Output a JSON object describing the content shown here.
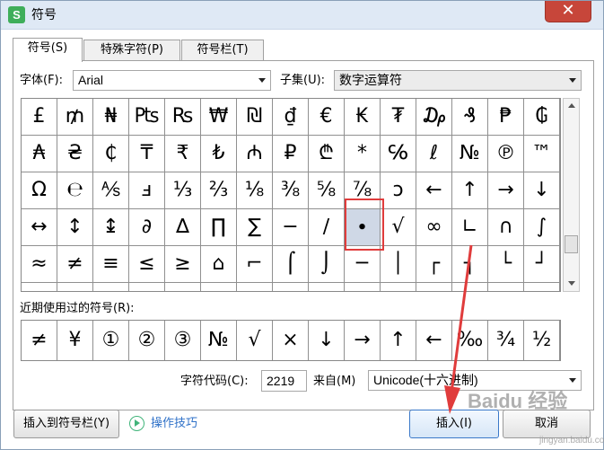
{
  "window": {
    "title": "符号",
    "app_icon_letter": "S",
    "close_label": "✕"
  },
  "tabs": [
    {
      "label": "符号(S)",
      "active": true
    },
    {
      "label": "特殊字符(P)",
      "active": false
    },
    {
      "label": "符号栏(T)",
      "active": false
    }
  ],
  "font": {
    "label": "字体(F):",
    "value": "Arial"
  },
  "subset": {
    "label": "子集(U):",
    "value": "数字运算符"
  },
  "grid": {
    "rows": [
      [
        "£",
        "₥",
        "₦",
        "₧",
        "₨",
        "₩",
        "₪",
        "₫",
        "€",
        "₭",
        "₮",
        "₯",
        "₰",
        "₱",
        "₲"
      ],
      [
        "₳",
        "₴",
        "₵",
        "₸",
        "₹",
        "₺",
        "₼",
        "₽",
        "₾",
        "*",
        "℅",
        "ℓ",
        "№",
        "℗",
        "™"
      ],
      [
        "Ω",
        "℮",
        "⅍",
        "ⅎ",
        "⅓",
        "⅔",
        "⅛",
        "⅜",
        "⅝",
        "⅞",
        "ↄ",
        "←",
        "↑",
        "→",
        "↓"
      ],
      [
        "↔",
        "↕",
        "↨",
        "∂",
        "∆",
        "∏",
        "∑",
        "−",
        "∕",
        "∙",
        "√",
        "∞",
        "∟",
        "∩",
        "∫"
      ],
      [
        "≈",
        "≠",
        "≡",
        "≤",
        "≥",
        "⌂",
        "⌐",
        "⌠",
        "⌡",
        "─",
        "│",
        "┌",
        "┐",
        "└",
        "┘"
      ],
      [
        "·",
        "·",
        "·",
        "·",
        "·",
        "·",
        "·",
        "·",
        "·",
        "·",
        "·",
        "·",
        "·",
        "·",
        "·"
      ]
    ],
    "selected": {
      "row": 3,
      "col": 9
    }
  },
  "recent": {
    "label": "近期使用过的符号(R):",
    "items": [
      "≠",
      "¥",
      "①",
      "②",
      "③",
      "№",
      "√",
      "×",
      "↓",
      "→",
      "↑",
      "←",
      "‰",
      "¾",
      "½"
    ]
  },
  "char_code": {
    "label": "字符代码(C):",
    "value": "2219"
  },
  "from": {
    "label": "来自(M)",
    "value": "Unicode(十六进制)"
  },
  "buttons": {
    "insert_to_bar": "插入到符号栏(Y)",
    "tips": "操作技巧",
    "insert": "插入(I)",
    "cancel": "取消"
  },
  "watermark": {
    "main": "Baidu 经验",
    "sub": "jingyan.baidu.com"
  },
  "colors": {
    "accent": "#3b79c9",
    "annotation": "#e03c3c",
    "tips": "#2f71c8"
  }
}
